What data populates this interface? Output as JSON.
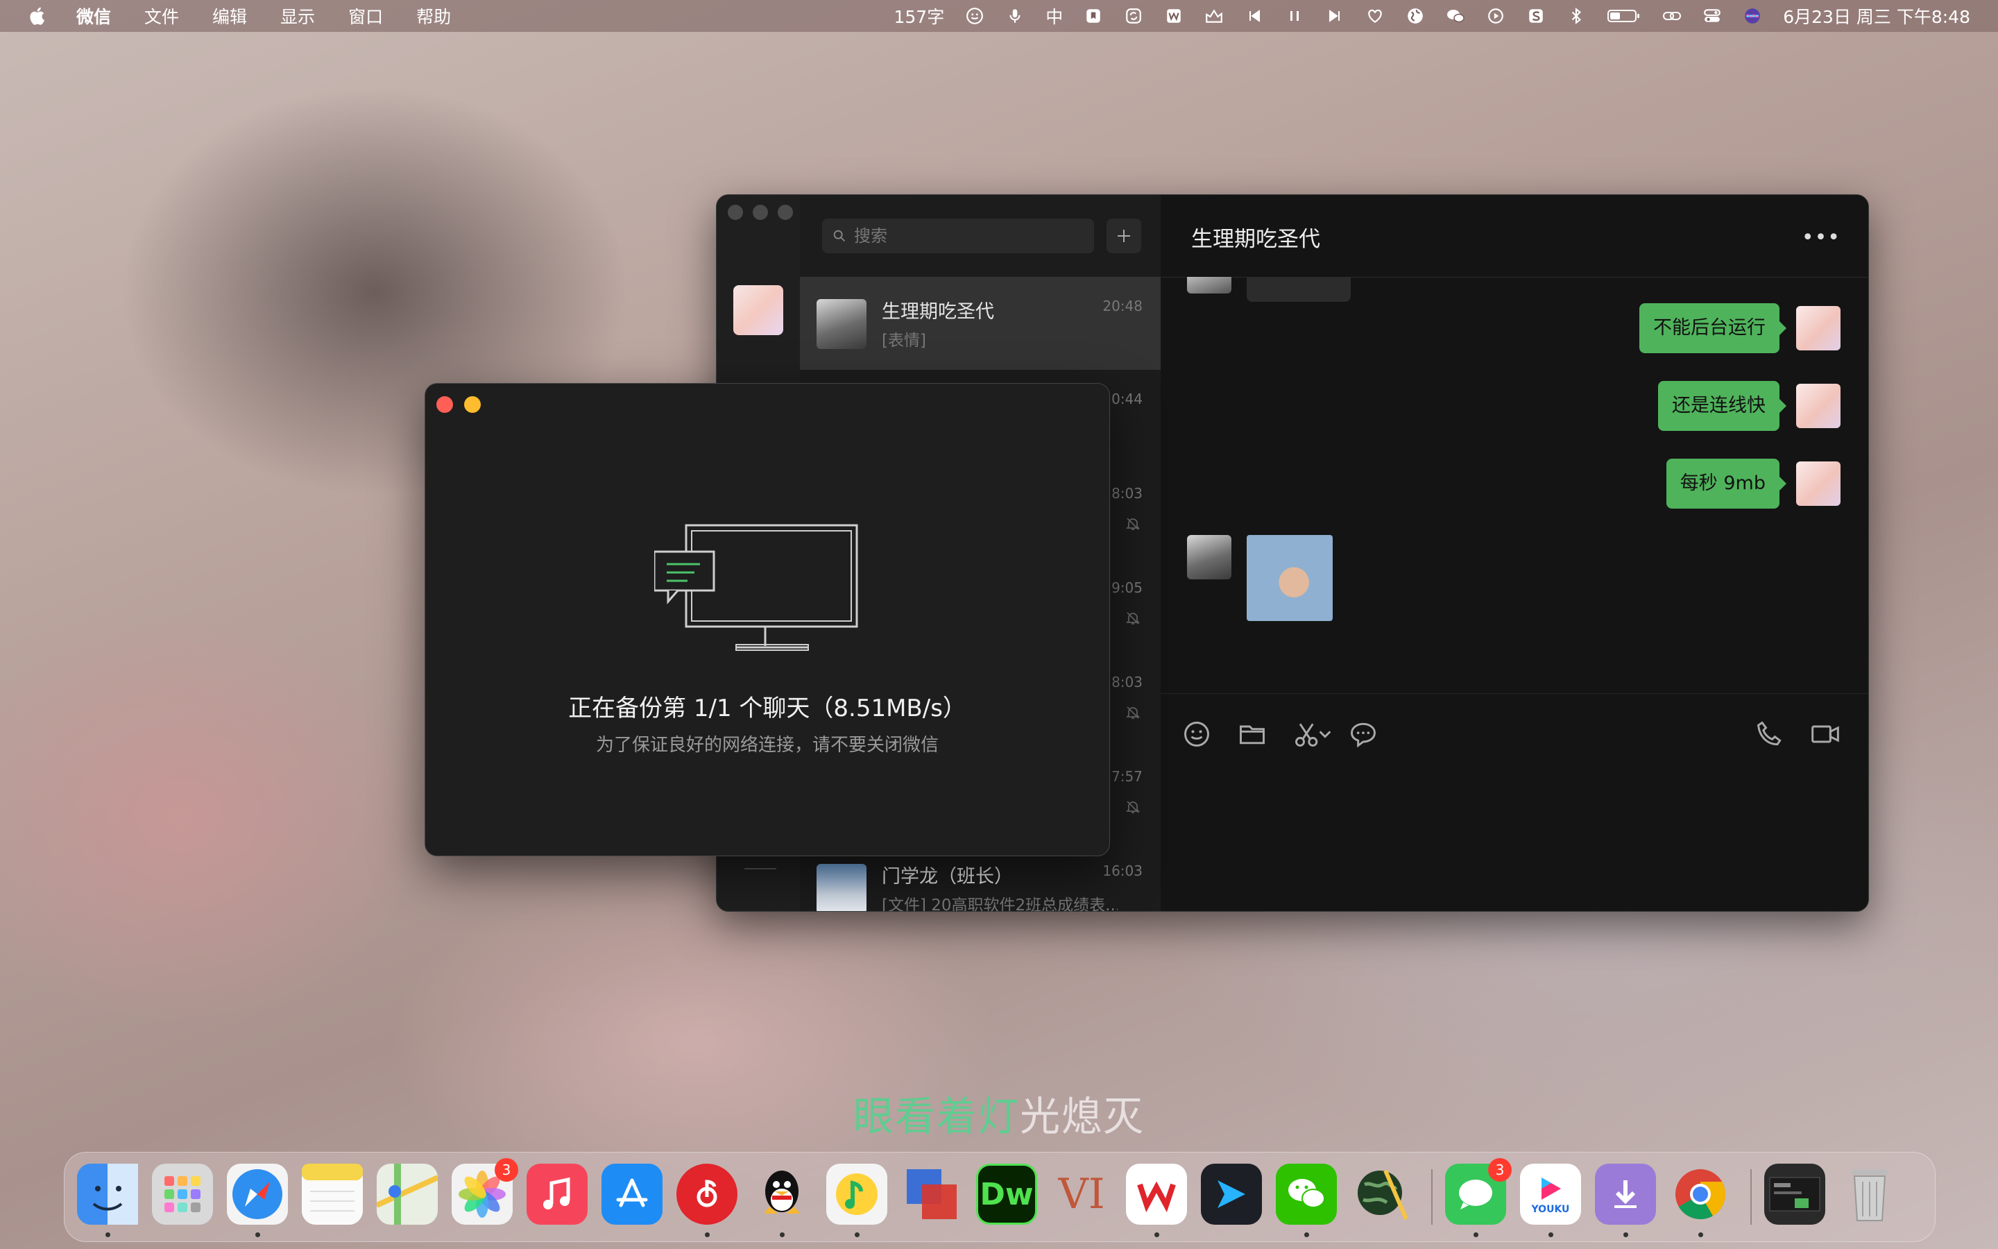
{
  "menubar": {
    "app_name": "微信",
    "items": [
      "文件",
      "编辑",
      "显示",
      "窗口",
      "帮助"
    ],
    "word_count": "157字",
    "input_method": "中",
    "datetime": "6月23日 周三 下午8:48"
  },
  "wechat": {
    "search_placeholder": "搜索",
    "chats": [
      {
        "name": "生理期吃圣代",
        "preview": "[表情]",
        "time": "20:48"
      },
      {
        "name": "",
        "preview": "",
        "time": "0:44"
      },
      {
        "name": "",
        "preview": "",
        "time": "8:03"
      },
      {
        "name": "",
        "preview": "",
        "time": "9:05"
      },
      {
        "name": "",
        "preview": "",
        "time": "8:03"
      },
      {
        "name": "",
        "preview": "",
        "time": "7:57"
      },
      {
        "name": "门学龙（班长）",
        "preview": "[文件] 20高职软件2班总成绩表...",
        "time": "16:03"
      }
    ],
    "conversation": {
      "title": "生理期吃圣代",
      "more": "•••",
      "messages": [
        "不能后台运行",
        "还是连线快",
        "每秒 9mb"
      ]
    }
  },
  "backup_dialog": {
    "status": "正在备份第 1/1 个聊天（8.51MB/s）",
    "hint": "为了保证良好的网络连接，请不要关闭微信"
  },
  "lyric": {
    "highlighted": "眼看着灯",
    "rest": "光熄灭"
  },
  "dock": {
    "items": [
      {
        "icon": "finder-icon",
        "color": "#3d8ef0"
      },
      {
        "icon": "launchpad-icon",
        "color": "#d9d9d9"
      },
      {
        "icon": "safari-icon",
        "color": "#2f8ff0"
      },
      {
        "icon": "notes-icon",
        "color": "#f7d54a"
      },
      {
        "icon": "maps-icon",
        "color": "#7ac46b"
      },
      {
        "icon": "photos-icon",
        "color": "#f2f2f2",
        "badge": "3"
      },
      {
        "icon": "music-icon",
        "color": "#f6455a"
      },
      {
        "icon": "app-store-icon",
        "color": "#1e8cf5"
      },
      {
        "icon": "netease-music-icon",
        "color": "#e1252b"
      },
      {
        "icon": "qq-icon",
        "color": "#ffffff"
      },
      {
        "icon": "qq-music-icon",
        "color": "#ffd23a"
      },
      {
        "icon": "parallels-icon",
        "color": "#3b6fd6"
      },
      {
        "icon": "dreamweaver-icon",
        "color": "#072401",
        "label": "Dw"
      },
      {
        "icon": "vi-icon",
        "color": "#c7b3b0",
        "label": "VI"
      },
      {
        "icon": "wps-icon",
        "color": "#ffffff"
      },
      {
        "icon": "prompt-icon",
        "color": "#1c1f26"
      },
      {
        "icon": "wechat-icon",
        "color": "#2dc100"
      },
      {
        "icon": "earth-icon",
        "color": "#1f3d23"
      },
      {
        "icon": "messages-icon",
        "color": "#35c759",
        "badge": "3"
      },
      {
        "icon": "youku-icon",
        "color": "#ffffff",
        "label": "YOUKU"
      },
      {
        "icon": "downloads-icon",
        "color": "#9a7bd8"
      },
      {
        "icon": "chrome-icon",
        "color": "#ffffff"
      },
      {
        "icon": "desktop-preview-icon",
        "color": "#2a2a2a"
      },
      {
        "icon": "trash-icon",
        "color": "#c8c8c8"
      }
    ]
  }
}
